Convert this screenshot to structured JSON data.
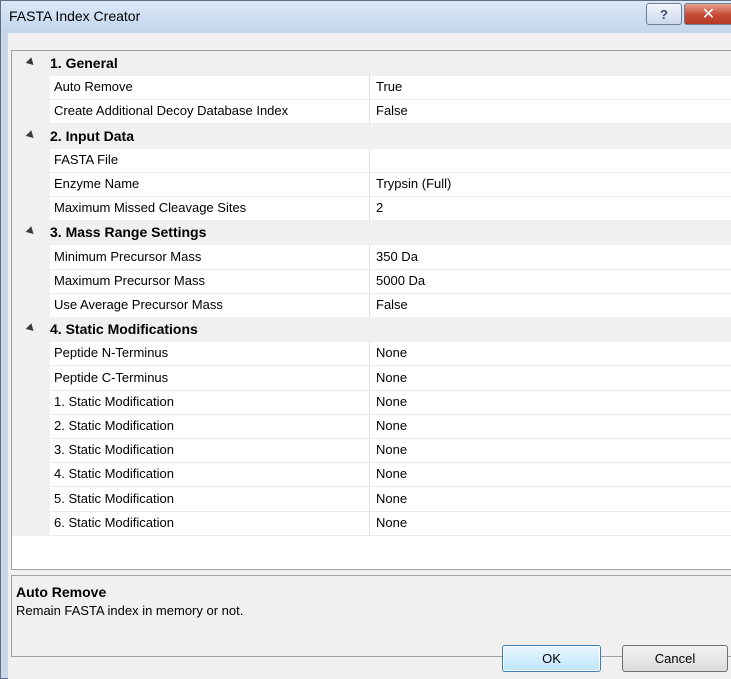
{
  "window": {
    "title": "FASTA Index Creator",
    "help_symbol": "?",
    "close_symbol": "✕"
  },
  "grid": {
    "categories": [
      {
        "label": "1. General",
        "properties": [
          {
            "name": "Auto Remove",
            "value": "True"
          },
          {
            "name": "Create Additional Decoy Database Index",
            "value": "False"
          }
        ]
      },
      {
        "label": "2. Input Data",
        "properties": [
          {
            "name": "FASTA File",
            "value": ""
          },
          {
            "name": "Enzyme Name",
            "value": "Trypsin (Full)"
          },
          {
            "name": "Maximum Missed Cleavage Sites",
            "value": "2"
          }
        ]
      },
      {
        "label": "3. Mass Range Settings",
        "properties": [
          {
            "name": "Minimum Precursor Mass",
            "value": "350 Da"
          },
          {
            "name": "Maximum Precursor Mass",
            "value": "5000 Da"
          },
          {
            "name": "Use Average Precursor Mass",
            "value": "False"
          }
        ]
      },
      {
        "label": "4. Static Modifications",
        "properties": [
          {
            "name": "Peptide N-Terminus",
            "value": "None"
          },
          {
            "name": "Peptide C-Terminus",
            "value": "None"
          },
          {
            "name": "1. Static Modification",
            "value": "None"
          },
          {
            "name": "2. Static Modification",
            "value": "None"
          },
          {
            "name": "3. Static Modification",
            "value": "None"
          },
          {
            "name": "4. Static Modification",
            "value": "None"
          },
          {
            "name": "5. Static Modification",
            "value": "None"
          },
          {
            "name": "6. Static Modification",
            "value": "None"
          }
        ]
      }
    ]
  },
  "help": {
    "title": "Auto Remove",
    "description": "Remain FASTA index in memory or not."
  },
  "buttons": {
    "ok": "OK",
    "cancel": "Cancel"
  }
}
